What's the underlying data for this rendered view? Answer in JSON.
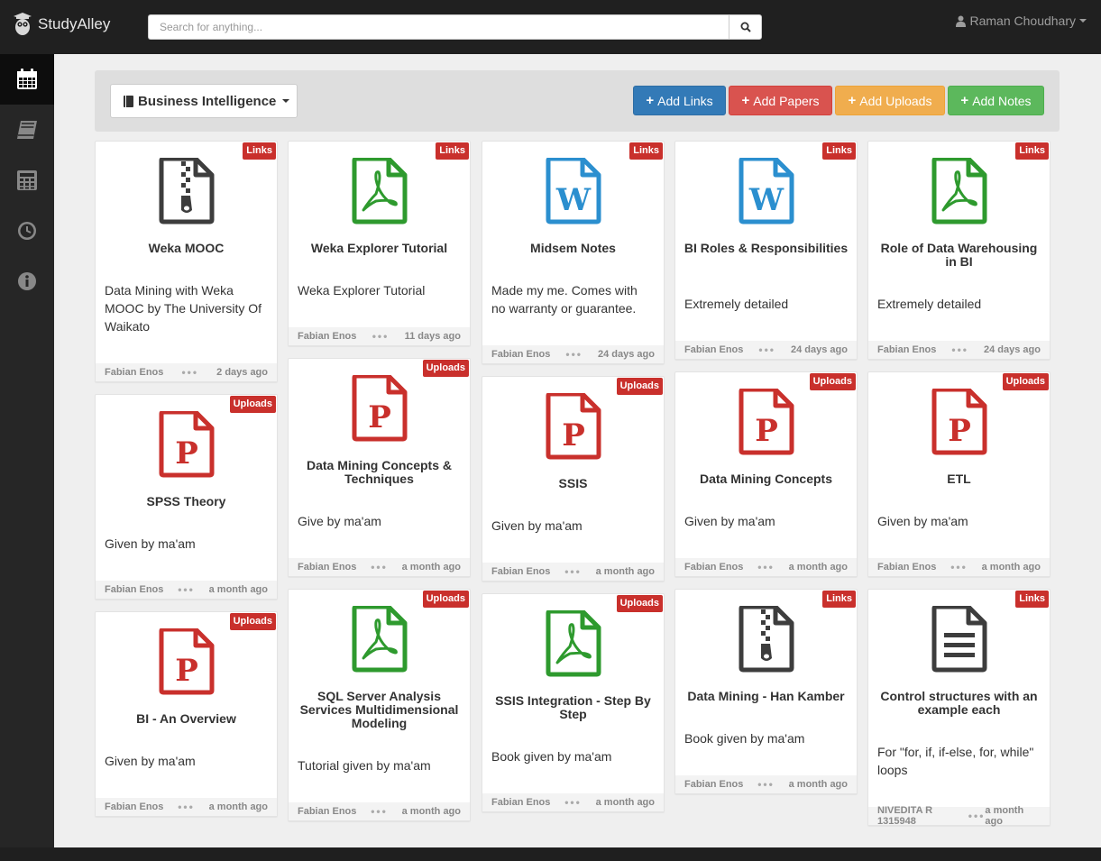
{
  "brand": {
    "name": "StudyAlley"
  },
  "search": {
    "placeholder": "Search for anything..."
  },
  "user": {
    "name": "Raman Choudhary"
  },
  "sidebar": {
    "items": [
      {
        "icon": "calendar-icon",
        "active": true
      },
      {
        "icon": "book-icon",
        "active": false
      },
      {
        "icon": "calculator-icon",
        "active": false
      },
      {
        "icon": "clock-icon",
        "active": false
      },
      {
        "icon": "info-icon",
        "active": false
      }
    ]
  },
  "toolbar": {
    "subject": "Business Intelligence",
    "add_links": "Add Links",
    "add_papers": "Add Papers",
    "add_uploads": "Add Uploads",
    "add_notes": "Add Notes"
  },
  "cards": [
    {
      "badge": "Links",
      "icon": "zip",
      "title": "Weka MOOC",
      "desc": "Data Mining with Weka MOOC by The University Of Waikato",
      "author": "Fabian Enos",
      "time": "2 days ago"
    },
    {
      "badge": "Uploads",
      "icon": "ppt",
      "title": "SPSS Theory",
      "desc": "Given by ma'am",
      "author": "Fabian Enos",
      "time": "a month ago"
    },
    {
      "badge": "Uploads",
      "icon": "ppt",
      "title": "BI - An Overview",
      "desc": "Given by ma'am",
      "author": "Fabian Enos",
      "time": "a month ago"
    },
    {
      "badge": "Links",
      "icon": "pdf",
      "title": "Weka Explorer Tutorial",
      "desc": "Weka Explorer Tutorial",
      "author": "Fabian Enos",
      "time": "11 days ago"
    },
    {
      "badge": "Uploads",
      "icon": "ppt",
      "title": "Data Mining Concepts & Techniques",
      "desc": "Give by ma'am",
      "author": "Fabian Enos",
      "time": "a month ago"
    },
    {
      "badge": "Uploads",
      "icon": "pdf",
      "title": "SQL Server Analysis Services Multidimensional Modeling",
      "desc": "Tutorial given by ma'am",
      "author": "Fabian Enos",
      "time": "a month ago"
    },
    {
      "badge": "Links",
      "icon": "word",
      "title": "Midsem Notes",
      "desc": "Made my me. Comes with no warranty or guarantee.",
      "author": "Fabian Enos",
      "time": "24 days ago"
    },
    {
      "badge": "Uploads",
      "icon": "ppt",
      "title": "SSIS",
      "desc": "Given by ma'am",
      "author": "Fabian Enos",
      "time": "a month ago"
    },
    {
      "badge": "Uploads",
      "icon": "pdf",
      "title": "SSIS Integration - Step By Step",
      "desc": "Book given by ma'am",
      "author": "Fabian Enos",
      "time": "a month ago"
    },
    {
      "badge": "Links",
      "icon": "word",
      "title": "BI Roles & Responsibilities",
      "desc": "Extremely detailed",
      "author": "Fabian Enos",
      "time": "24 days ago"
    },
    {
      "badge": "Uploads",
      "icon": "ppt",
      "title": "Data Mining Concepts",
      "desc": "Given by ma'am",
      "author": "Fabian Enos",
      "time": "a month ago"
    },
    {
      "badge": "Links",
      "icon": "zip",
      "title": "Data Mining - Han Kamber",
      "desc": "Book given by ma'am",
      "author": "Fabian Enos",
      "time": "a month ago"
    },
    {
      "badge": "Links",
      "icon": "pdf",
      "title": "Role of Data Warehousing in BI",
      "desc": "Extremely detailed",
      "author": "Fabian Enos",
      "time": "24 days ago"
    },
    {
      "badge": "Uploads",
      "icon": "ppt",
      "title": "ETL",
      "desc": "Given by ma'am",
      "author": "Fabian Enos",
      "time": "a month ago"
    },
    {
      "badge": "Links",
      "icon": "text",
      "title": "Control structures with an example each",
      "desc": "For \"for, if, if-else, for, while\" loops",
      "author": "NIVEDITA R 1315948",
      "time": "a month ago"
    }
  ],
  "colors": {
    "zip": "#3d3d3d",
    "pdf": "#2e9a2e",
    "word": "#2b8fcf",
    "ppt": "#c9302c",
    "text": "#3d3d3d",
    "badge": "#c9302c"
  }
}
